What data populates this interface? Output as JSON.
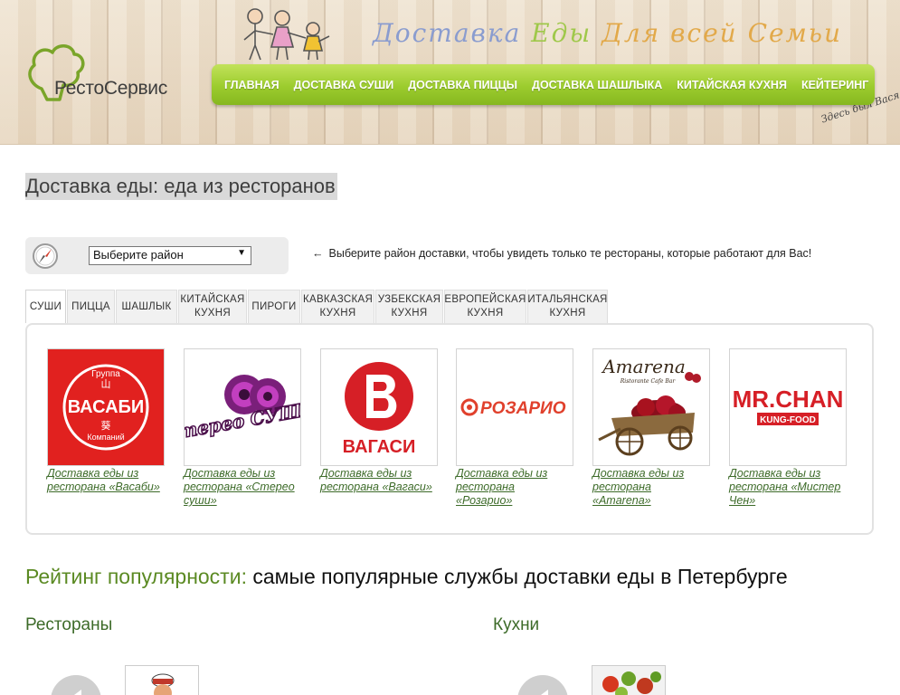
{
  "header": {
    "logo_text": "РестоСервис",
    "slogan_part1": "Доставка",
    "slogan_part2": "Еды",
    "slogan_part3": "Для всей Семьи",
    "scribble": "Здесь был Вася",
    "nav": [
      "ГЛАВНАЯ",
      "ДОСТАВКА СУШИ",
      "ДОСТАВКА ПИЦЦЫ",
      "ДОСТАВКА ШАШЛЫКА",
      "КИТАЙСКАЯ КУХНЯ",
      "КЕЙТЕРИНГ"
    ]
  },
  "page_title": "Доставка еды: еда из ресторанов",
  "district": {
    "select_value": "Выберите район",
    "hint": "Выберите район доставки, чтобы увидеть только те рестораны, которые работают для Вас!"
  },
  "tabs": [
    {
      "label": "СУШИ",
      "active": true
    },
    {
      "label": "ПИЦЦА",
      "active": false
    },
    {
      "label": "ШАШЛЫК",
      "active": false
    },
    {
      "label": "КИТАЙСКАЯ КУХНЯ",
      "active": false
    },
    {
      "label": "ПИРОГИ",
      "active": false
    },
    {
      "label": "КАВКАЗСКАЯ КУХНЯ",
      "active": false
    },
    {
      "label": "УЗБЕКСКАЯ КУХНЯ",
      "active": false
    },
    {
      "label": "ЕВРОПЕЙСКАЯ КУХНЯ",
      "active": false
    },
    {
      "label": "ИТАЛЬЯНСКАЯ КУХНЯ",
      "active": false
    }
  ],
  "restaurants": [
    {
      "logo_text": "ВАСАБИ",
      "logo_top": "Группа",
      "logo_bottom": "Компаний",
      "link": "Доставка еды из ресторана «Васаби»"
    },
    {
      "logo_text": "Стерео СУШИ",
      "link": "Доставка еды из ресторана «Стерео суши»"
    },
    {
      "logo_text": "ВАГАСИ",
      "link": "Доставка еды из ресторана «Вагаси»"
    },
    {
      "logo_text": "РОЗАРИО",
      "link": "Доставка еды из ресторана «Розарио»"
    },
    {
      "logo_text": "Amarena",
      "logo_sub": "Ristorante Cafe Bar",
      "link": "Доставка еды из ресторана «Amarena»"
    },
    {
      "logo_text": "MR.CHAN",
      "logo_sub": "KUNG-FOOD",
      "link": "Доставка еды из ресторана «Мистер Чен»"
    }
  ],
  "rating": {
    "title_green": "Рейтинг популярности:",
    "title_rest": " самые популярные службы доставки еды в Петербурге",
    "col_restaurants": "Рестораны",
    "col_cuisines": "Кухни"
  },
  "colors": {
    "nav_green": "#9ccc2e",
    "link_green": "#3d6b29",
    "wasabi_red": "#e1211f",
    "stereo_purple": "#7a1f7a",
    "vagasi_red": "#d61f26",
    "rosario_red": "#e0402c",
    "mrchan_red": "#d61f26"
  }
}
